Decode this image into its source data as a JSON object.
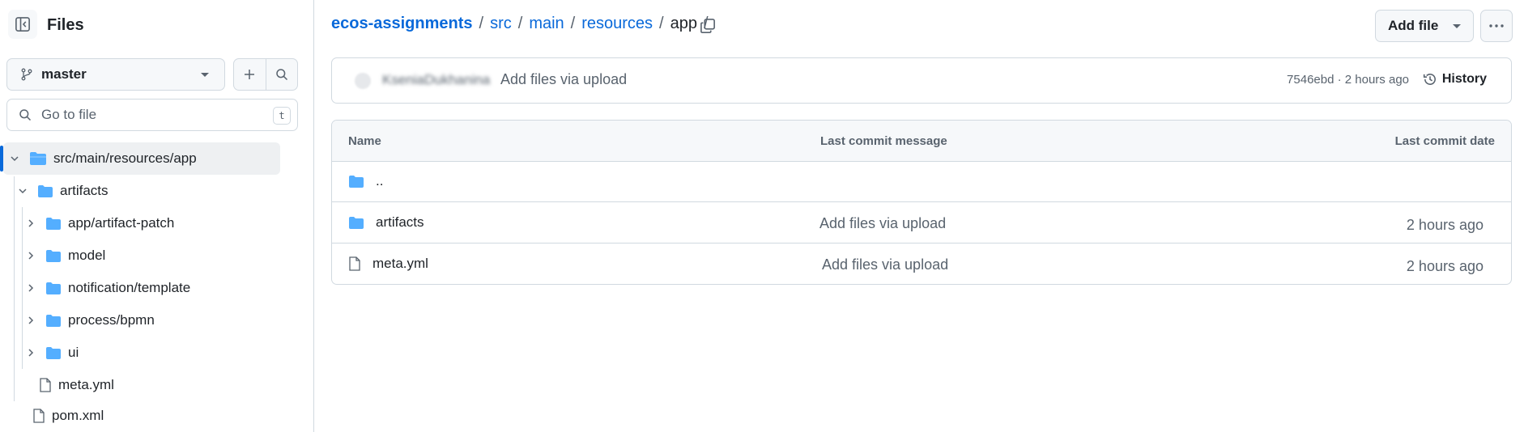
{
  "sidebar": {
    "title": "Files",
    "branch": "master",
    "goto_placeholder": "Go to file",
    "goto_shortcut": "t",
    "tree": [
      {
        "label": "src/main/resources/app",
        "type": "folder-open",
        "expanded": true,
        "selected": true
      },
      {
        "label": "artifacts",
        "type": "folder",
        "expanded": true
      },
      {
        "label": "app/artifact-patch",
        "type": "folder",
        "expanded": false
      },
      {
        "label": "model",
        "type": "folder",
        "expanded": false
      },
      {
        "label": "notification/template",
        "type": "folder",
        "expanded": false
      },
      {
        "label": "process/bpmn",
        "type": "folder",
        "expanded": false
      },
      {
        "label": "ui",
        "type": "folder",
        "expanded": false
      },
      {
        "label": "meta.yml",
        "type": "file"
      },
      {
        "label": "pom.xml",
        "type": "file"
      }
    ]
  },
  "breadcrumb": {
    "repo": "ecos-assignments",
    "parts": [
      "src",
      "main",
      "resources"
    ],
    "current": "app",
    "sep": "/"
  },
  "header": {
    "add_file": "Add file"
  },
  "commit": {
    "author": "KseniaDukhanina",
    "message": "Add files via upload",
    "meta": "7546ebd · 2 hours ago",
    "history": "History"
  },
  "table": {
    "headers": {
      "name": "Name",
      "message": "Last commit message",
      "date": "Last commit date"
    },
    "rows": [
      {
        "name": "..",
        "type": "folder",
        "message": "",
        "date": ""
      },
      {
        "name": "artifacts",
        "type": "folder",
        "message": "Add files via upload",
        "date": "2 hours ago"
      },
      {
        "name": "meta.yml",
        "type": "file",
        "message": "Add files via upload",
        "date": "2 hours ago"
      }
    ]
  },
  "colors": {
    "link": "#0969da",
    "folder": "#54aeff",
    "muted": "#59636e",
    "border": "#d1d9e0",
    "selected_bg": "#eef0f2"
  }
}
